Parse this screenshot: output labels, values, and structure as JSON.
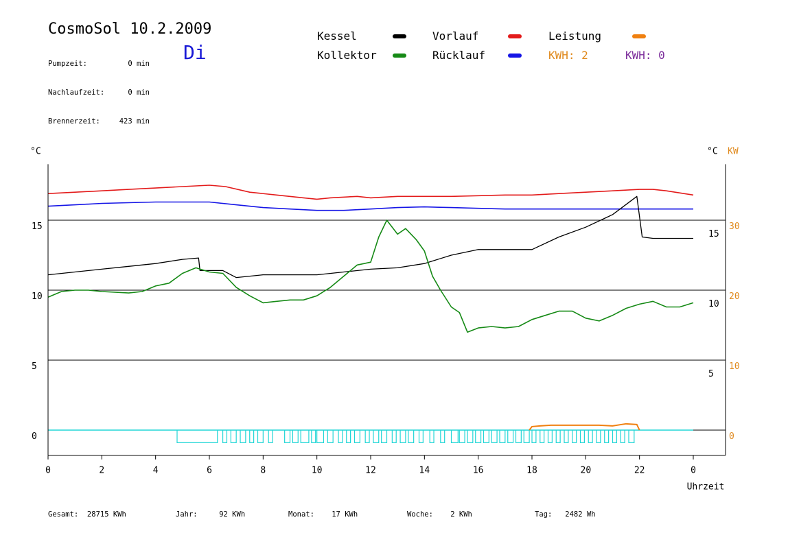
{
  "header": {
    "title": "CosmoSol 10.2.2009",
    "weekday": "Di",
    "info": [
      {
        "label": "Pumpzeit:",
        "value": "0 min"
      },
      {
        "label": "Nachlaufzeit:",
        "value": "0 min"
      },
      {
        "label": "Brennerzeit:",
        "value": "423 min"
      }
    ]
  },
  "legend": {
    "items": [
      {
        "label": "Kessel",
        "color": "#000000"
      },
      {
        "label": "Vorlauf",
        "color": "#e31b1b"
      },
      {
        "label": "Leistung",
        "color": "#f08010"
      },
      {
        "label": "Kollektor",
        "color": "#168a16"
      },
      {
        "label": "Rücklauf",
        "color": "#1515e6"
      }
    ],
    "kwh_orange": "KWH: 2",
    "kwh_purple": "KWH: 0",
    "kwh_orange_color": "#e08a1e",
    "kwh_purple_color": "#7a2a9a"
  },
  "footer": {
    "items": [
      {
        "label": "Gesamt:",
        "value": "28715 KWh"
      },
      {
        "label": "Jahr:",
        "value": "92 KWh"
      },
      {
        "label": "Monat:",
        "value": "17 KWh"
      },
      {
        "label": "Woche:",
        "value": "2 KWh"
      },
      {
        "label": "Tag:",
        "value": "2482 Wh"
      }
    ]
  },
  "chart_data": {
    "type": "line",
    "title": "CosmoSol 10.2.2009",
    "xlabel": "Uhrzeit",
    "ylabel_left": "°C",
    "ylabel_right_1": "°C",
    "ylabel_right_2": "KW",
    "xlim": [
      0,
      24
    ],
    "ylim": [
      -1.8,
      19
    ],
    "x_ticks": [
      0,
      2,
      4,
      6,
      8,
      10,
      12,
      14,
      16,
      18,
      20,
      22,
      24
    ],
    "x_tick_labels": [
      "0",
      "2",
      "4",
      "6",
      "8",
      "10",
      "12",
      "14",
      "16",
      "18",
      "20",
      "22",
      "0"
    ],
    "y_ticks_left": [
      0,
      5,
      10,
      15
    ],
    "y_tick_labels_left": [
      "0",
      "5",
      "10",
      "15"
    ],
    "y_tick_labels_right_c": [
      "5",
      "10",
      "15"
    ],
    "y_tick_labels_right_kw": [
      "0",
      "10",
      "20",
      "30"
    ],
    "grid_y": [
      0,
      5,
      10,
      15
    ],
    "series": [
      {
        "name": "Vorlauf",
        "color": "#e31b1b",
        "x": [
          0,
          1,
          2,
          3,
          4,
          5,
          6,
          6.6,
          7.5,
          8.5,
          9.5,
          10,
          10.5,
          11.5,
          12,
          13,
          14,
          15,
          16,
          17,
          18,
          19,
          20,
          21,
          22,
          22.5,
          23,
          24
        ],
        "y": [
          16.9,
          17.0,
          17.1,
          17.2,
          17.3,
          17.4,
          17.5,
          17.4,
          17.0,
          16.8,
          16.6,
          16.5,
          16.6,
          16.7,
          16.6,
          16.7,
          16.7,
          16.7,
          16.75,
          16.8,
          16.8,
          16.9,
          17.0,
          17.1,
          17.2,
          17.2,
          17.1,
          16.8
        ]
      },
      {
        "name": "Rücklauf",
        "color": "#1515e6",
        "x": [
          0,
          1,
          2,
          3,
          4,
          5,
          6,
          7,
          8,
          9,
          10,
          11,
          12,
          13,
          14,
          15,
          16,
          17,
          18,
          19,
          20,
          21,
          22,
          23,
          24
        ],
        "y": [
          16.0,
          16.1,
          16.2,
          16.25,
          16.3,
          16.3,
          16.3,
          16.1,
          15.9,
          15.8,
          15.7,
          15.7,
          15.8,
          15.9,
          15.95,
          15.9,
          15.85,
          15.8,
          15.8,
          15.8,
          15.8,
          15.8,
          15.8,
          15.8,
          15.8
        ]
      },
      {
        "name": "Kessel",
        "color": "#000000",
        "x": [
          0,
          1,
          2,
          3,
          4,
          5,
          5.6,
          5.65,
          6.5,
          7.0,
          7.5,
          8,
          9,
          10,
          11,
          12,
          13,
          14,
          15,
          16,
          17,
          18,
          19,
          20,
          21,
          21.9,
          22.1,
          22.5,
          24
        ],
        "y": [
          11.1,
          11.3,
          11.5,
          11.7,
          11.9,
          12.2,
          12.3,
          11.4,
          11.4,
          10.9,
          11.0,
          11.1,
          11.1,
          11.1,
          11.3,
          11.5,
          11.6,
          11.9,
          12.5,
          12.9,
          12.9,
          12.9,
          13.8,
          14.5,
          15.4,
          16.7,
          13.8,
          13.7,
          13.7
        ]
      },
      {
        "name": "Kollektor",
        "color": "#168a16",
        "x": [
          0,
          0.5,
          1,
          1.5,
          2,
          3,
          3.5,
          4,
          4.5,
          5,
          5.5,
          6,
          6.5,
          7,
          7.5,
          8,
          8.5,
          9,
          9.5,
          10,
          10.5,
          11,
          11.5,
          12,
          12.3,
          12.6,
          13,
          13.3,
          13.7,
          14,
          14.3,
          14.6,
          15,
          15.3,
          15.6,
          16,
          16.5,
          17,
          17.5,
          18,
          18.5,
          19,
          19.5,
          20,
          20.5,
          21,
          21.5,
          22,
          22.5,
          23,
          23.5,
          24
        ],
        "y": [
          9.5,
          9.9,
          10.0,
          10.0,
          9.9,
          9.8,
          9.9,
          10.3,
          10.5,
          11.2,
          11.6,
          11.3,
          11.2,
          10.2,
          9.6,
          9.1,
          9.2,
          9.3,
          9.3,
          9.6,
          10.2,
          11.0,
          11.8,
          12.0,
          13.8,
          15.0,
          14.0,
          14.4,
          13.6,
          12.8,
          11.0,
          10.0,
          8.8,
          8.4,
          7.0,
          7.3,
          7.4,
          7.3,
          7.4,
          7.9,
          8.2,
          8.5,
          8.5,
          8.0,
          7.8,
          8.2,
          8.7,
          9.0,
          9.2,
          8.8,
          8.8,
          9.1
        ]
      }
    ],
    "pump_pulses": {
      "color": "#20d6d6",
      "baseline": 0,
      "starts": [
        4.8,
        6.5,
        6.8,
        7.15,
        7.5,
        7.8,
        8.2,
        8.8,
        9.1,
        9.4,
        9.8,
        10.0,
        10.4,
        10.8,
        11.1,
        11.4,
        11.8,
        12.1,
        12.4,
        12.8,
        13.1,
        13.4,
        13.8,
        14.2,
        14.6,
        15.0,
        15.3,
        15.6,
        15.9,
        16.2,
        16.5,
        16.8,
        17.1,
        17.4,
        17.7,
        18.0,
        18.3,
        18.6,
        18.9,
        19.2,
        19.5,
        19.8,
        20.1,
        20.4,
        20.7,
        21.0,
        21.3,
        21.6
      ],
      "ends": [
        6.3,
        6.65,
        7.0,
        7.35,
        7.65,
        8.0,
        8.35,
        9.0,
        9.3,
        9.7,
        9.95,
        10.25,
        10.6,
        10.95,
        11.25,
        11.6,
        11.95,
        12.3,
        12.6,
        12.95,
        13.3,
        13.6,
        13.95,
        14.35,
        14.75,
        15.25,
        15.5,
        15.8,
        16.1,
        16.4,
        16.7,
        17.0,
        17.3,
        17.6,
        17.9,
        18.15,
        18.45,
        18.75,
        19.05,
        19.35,
        19.65,
        19.95,
        20.25,
        20.55,
        20.85,
        21.15,
        21.45,
        21.8
      ],
      "depth": -0.9
    },
    "leistung": {
      "color": "#f08010",
      "x": [
        17.9,
        18.0,
        18.3,
        18.7,
        19.5,
        20.5,
        21.0,
        21.5,
        21.9,
        22.0
      ],
      "y": [
        0,
        0.25,
        0.3,
        0.35,
        0.35,
        0.35,
        0.3,
        0.45,
        0.4,
        0
      ]
    }
  }
}
